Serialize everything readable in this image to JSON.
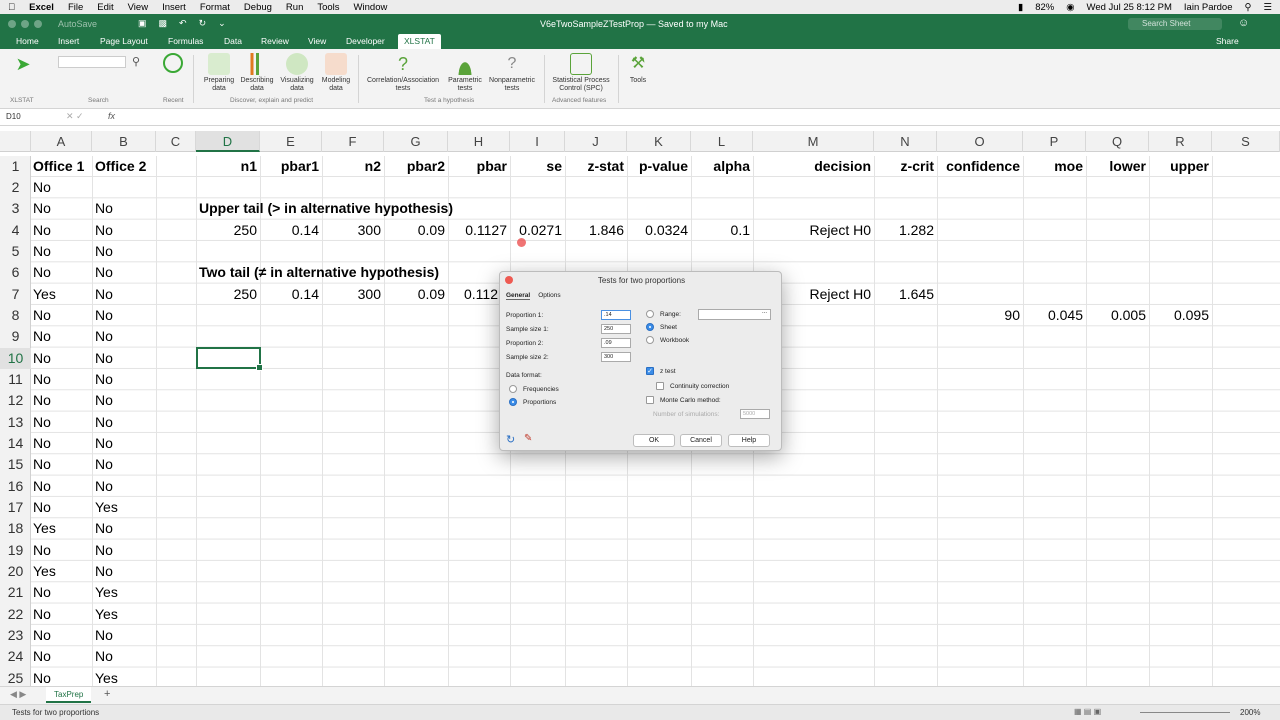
{
  "menubar": {
    "app": "Excel",
    "items": [
      "File",
      "Edit",
      "View",
      "Insert",
      "Format",
      "Debug",
      "Run",
      "Tools",
      "Window"
    ],
    "battery": "82%",
    "datetime": "Wed Jul 25  8:12 PM",
    "user": "Iain Pardoe"
  },
  "titlebar": {
    "autosave": "AutoSave",
    "document": "V6eTwoSampleZTestProp — Saved to my Mac",
    "search_placeholder": "Search Sheet"
  },
  "ribbon_tabs": {
    "items": [
      "Home",
      "Insert",
      "Page Layout",
      "Formulas",
      "Data",
      "Review",
      "View",
      "Developer",
      "XLSTAT"
    ],
    "active": "XLSTAT",
    "share": "Share"
  },
  "ribbon": {
    "xlstat": "XLSTAT",
    "search": "Search",
    "recent": "Recent",
    "preparing": "Preparing\ndata",
    "describing": "Describing\ndata",
    "visualizing": "Visualizing\ndata",
    "modeling": "Modeling\ndata",
    "group_discover": "Discover, explain and predict",
    "correlation": "Correlation/Association\ntests",
    "parametric": "Parametric\ntests",
    "nonparametric": "Nonparametric\ntests",
    "group_test": "Test a hypothesis",
    "spc": "Statistical Process\nControl (SPC)",
    "group_advanced": "Advanced features",
    "tools": "Tools"
  },
  "formula": {
    "namebox": "D10",
    "fx": "fx",
    "value": ""
  },
  "columns": [
    "A",
    "B",
    "C",
    "D",
    "E",
    "F",
    "G",
    "H",
    "I",
    "J",
    "K",
    "L",
    "M",
    "N",
    "O",
    "P",
    "Q",
    "R",
    "S"
  ],
  "selected_column": "D",
  "rows": [
    "1",
    "2",
    "3",
    "4",
    "5",
    "6",
    "7",
    "8",
    "9",
    "10",
    "11",
    "12",
    "13",
    "14",
    "15",
    "16",
    "17",
    "18",
    "19",
    "20",
    "21",
    "22",
    "23",
    "24",
    "25"
  ],
  "selected_row": "10",
  "sheet": {
    "row1": {
      "A": "Office 1",
      "B": "Office 2",
      "D": "n1",
      "E": "pbar1",
      "F": "n2",
      "G": "pbar2",
      "H": "pbar",
      "I": "se",
      "J": "z-stat",
      "K": "p-value",
      "L": "alpha",
      "M": "decision",
      "N": "z-crit",
      "O": "confidence",
      "P": "moe",
      "Q": "lower",
      "R": "upper"
    },
    "colA": [
      "No",
      "No",
      "No",
      "No",
      "No",
      "Yes",
      "No",
      "No",
      "No",
      "No",
      "No",
      "No",
      "No",
      "No",
      "No",
      "No",
      "Yes",
      "No",
      "Yes",
      "No",
      "No",
      "No",
      "No",
      "No"
    ],
    "colB": [
      "",
      "No",
      "No",
      "No",
      "No",
      "No",
      "No",
      "No",
      "No",
      "No",
      "No",
      "No",
      "No",
      "No",
      "No",
      "Yes",
      "No",
      "No",
      "No",
      "Yes",
      "Yes",
      "No",
      "No",
      "Yes"
    ],
    "upper_tail_heading": "Upper tail (> in alternative hypothesis)",
    "row4": {
      "D": "250",
      "E": "0.14",
      "F": "300",
      "G": "0.09",
      "H": "0.1127",
      "I": "0.0271",
      "J": "1.846",
      "K": "0.0324",
      "L": "0.1",
      "M": "Reject H0",
      "N": "1.282"
    },
    "two_tail_heading": "Two tail (≠ in alternative hypothesis)",
    "row7": {
      "D": "250",
      "E": "0.14",
      "F": "300",
      "G": "0.09",
      "H": "0.112",
      "M": "Reject H0",
      "N": "1.645"
    },
    "row8": {
      "O": "90",
      "P": "0.045",
      "Q": "0.005",
      "R": "0.095"
    }
  },
  "sheet_tab": "TaxPrep",
  "status": {
    "text": "Tests for two proportions",
    "zoom": "200%"
  },
  "dialog": {
    "title": "Tests for two proportions",
    "tabs": [
      "General",
      "Options"
    ],
    "proportion1_label": "Proportion 1:",
    "proportion1_value": ".14",
    "sample1_label": "Sample size 1:",
    "sample1_value": "250",
    "proportion2_label": "Proportion 2:",
    "proportion2_value": ".09",
    "sample2_label": "Sample size 2:",
    "sample2_value": "300",
    "data_format_label": "Data format:",
    "frequencies": "Frequencies",
    "proportions": "Proportions",
    "range": "Range:",
    "sheet": "Sheet",
    "workbook": "Workbook",
    "ztest": "z test",
    "continuity": "Continuity correction",
    "montecarlo": "Monte Carlo method:",
    "simulations_label": "Number of simulations:",
    "simulations_value": "5000",
    "ok": "OK",
    "cancel": "Cancel",
    "help": "Help"
  },
  "colors": {
    "excel_green": "#217346",
    "dialog_bg": "#ececec"
  }
}
